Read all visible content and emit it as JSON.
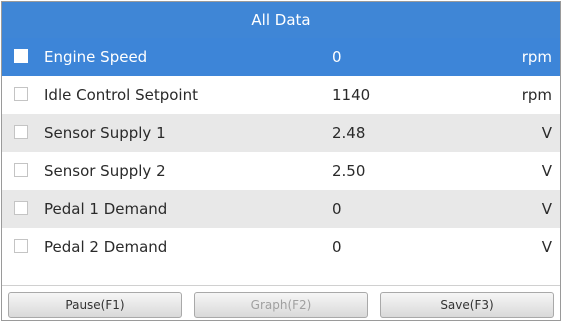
{
  "header": {
    "title": "All Data"
  },
  "rows": [
    {
      "name": "Engine Speed",
      "value": "0",
      "unit": "rpm",
      "checked": false
    },
    {
      "name": "Idle Control Setpoint",
      "value": "1140",
      "unit": "rpm",
      "checked": false
    },
    {
      "name": "Sensor Supply 1",
      "value": "2.48",
      "unit": "V",
      "checked": false
    },
    {
      "name": "Sensor Supply 2",
      "value": "2.50",
      "unit": "V",
      "checked": false
    },
    {
      "name": "Pedal 1 Demand",
      "value": "0",
      "unit": "V",
      "checked": false
    },
    {
      "name": "Pedal 2 Demand",
      "value": "0",
      "unit": "V",
      "checked": false
    }
  ],
  "footer": {
    "pause_label": "Pause(F1)",
    "graph_label": "Graph(F2)",
    "save_label": "Save(F3)"
  },
  "colors": {
    "title_bar": "#3f86d6",
    "selected_row": "#3d85d8",
    "alt_row": "#e8e8e8"
  }
}
